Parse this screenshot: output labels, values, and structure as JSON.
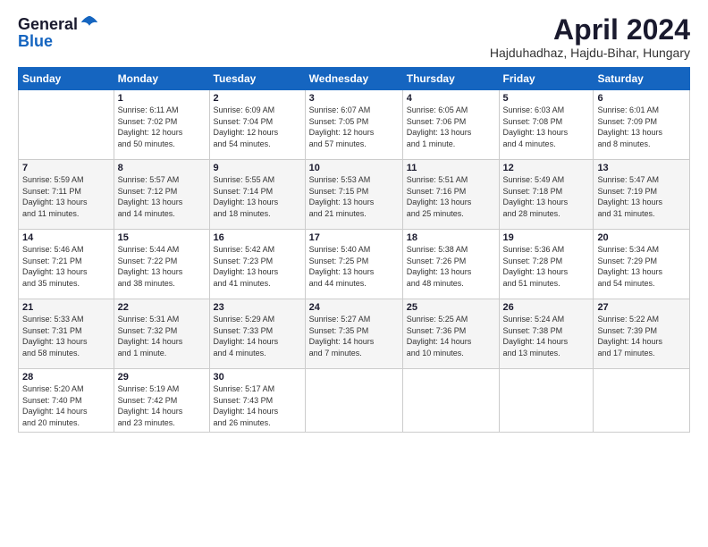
{
  "header": {
    "logo_line1": "General",
    "logo_line2": "Blue",
    "title": "April 2024",
    "subtitle": "Hajduhadhaz, Hajdu-Bihar, Hungary"
  },
  "weekdays": [
    "Sunday",
    "Monday",
    "Tuesday",
    "Wednesday",
    "Thursday",
    "Friday",
    "Saturday"
  ],
  "weeks": [
    [
      {
        "day": "",
        "info": ""
      },
      {
        "day": "1",
        "info": "Sunrise: 6:11 AM\nSunset: 7:02 PM\nDaylight: 12 hours\nand 50 minutes."
      },
      {
        "day": "2",
        "info": "Sunrise: 6:09 AM\nSunset: 7:04 PM\nDaylight: 12 hours\nand 54 minutes."
      },
      {
        "day": "3",
        "info": "Sunrise: 6:07 AM\nSunset: 7:05 PM\nDaylight: 12 hours\nand 57 minutes."
      },
      {
        "day": "4",
        "info": "Sunrise: 6:05 AM\nSunset: 7:06 PM\nDaylight: 13 hours\nand 1 minute."
      },
      {
        "day": "5",
        "info": "Sunrise: 6:03 AM\nSunset: 7:08 PM\nDaylight: 13 hours\nand 4 minutes."
      },
      {
        "day": "6",
        "info": "Sunrise: 6:01 AM\nSunset: 7:09 PM\nDaylight: 13 hours\nand 8 minutes."
      }
    ],
    [
      {
        "day": "7",
        "info": "Sunrise: 5:59 AM\nSunset: 7:11 PM\nDaylight: 13 hours\nand 11 minutes."
      },
      {
        "day": "8",
        "info": "Sunrise: 5:57 AM\nSunset: 7:12 PM\nDaylight: 13 hours\nand 14 minutes."
      },
      {
        "day": "9",
        "info": "Sunrise: 5:55 AM\nSunset: 7:14 PM\nDaylight: 13 hours\nand 18 minutes."
      },
      {
        "day": "10",
        "info": "Sunrise: 5:53 AM\nSunset: 7:15 PM\nDaylight: 13 hours\nand 21 minutes."
      },
      {
        "day": "11",
        "info": "Sunrise: 5:51 AM\nSunset: 7:16 PM\nDaylight: 13 hours\nand 25 minutes."
      },
      {
        "day": "12",
        "info": "Sunrise: 5:49 AM\nSunset: 7:18 PM\nDaylight: 13 hours\nand 28 minutes."
      },
      {
        "day": "13",
        "info": "Sunrise: 5:47 AM\nSunset: 7:19 PM\nDaylight: 13 hours\nand 31 minutes."
      }
    ],
    [
      {
        "day": "14",
        "info": "Sunrise: 5:46 AM\nSunset: 7:21 PM\nDaylight: 13 hours\nand 35 minutes."
      },
      {
        "day": "15",
        "info": "Sunrise: 5:44 AM\nSunset: 7:22 PM\nDaylight: 13 hours\nand 38 minutes."
      },
      {
        "day": "16",
        "info": "Sunrise: 5:42 AM\nSunset: 7:23 PM\nDaylight: 13 hours\nand 41 minutes."
      },
      {
        "day": "17",
        "info": "Sunrise: 5:40 AM\nSunset: 7:25 PM\nDaylight: 13 hours\nand 44 minutes."
      },
      {
        "day": "18",
        "info": "Sunrise: 5:38 AM\nSunset: 7:26 PM\nDaylight: 13 hours\nand 48 minutes."
      },
      {
        "day": "19",
        "info": "Sunrise: 5:36 AM\nSunset: 7:28 PM\nDaylight: 13 hours\nand 51 minutes."
      },
      {
        "day": "20",
        "info": "Sunrise: 5:34 AM\nSunset: 7:29 PM\nDaylight: 13 hours\nand 54 minutes."
      }
    ],
    [
      {
        "day": "21",
        "info": "Sunrise: 5:33 AM\nSunset: 7:31 PM\nDaylight: 13 hours\nand 58 minutes."
      },
      {
        "day": "22",
        "info": "Sunrise: 5:31 AM\nSunset: 7:32 PM\nDaylight: 14 hours\nand 1 minute."
      },
      {
        "day": "23",
        "info": "Sunrise: 5:29 AM\nSunset: 7:33 PM\nDaylight: 14 hours\nand 4 minutes."
      },
      {
        "day": "24",
        "info": "Sunrise: 5:27 AM\nSunset: 7:35 PM\nDaylight: 14 hours\nand 7 minutes."
      },
      {
        "day": "25",
        "info": "Sunrise: 5:25 AM\nSunset: 7:36 PM\nDaylight: 14 hours\nand 10 minutes."
      },
      {
        "day": "26",
        "info": "Sunrise: 5:24 AM\nSunset: 7:38 PM\nDaylight: 14 hours\nand 13 minutes."
      },
      {
        "day": "27",
        "info": "Sunrise: 5:22 AM\nSunset: 7:39 PM\nDaylight: 14 hours\nand 17 minutes."
      }
    ],
    [
      {
        "day": "28",
        "info": "Sunrise: 5:20 AM\nSunset: 7:40 PM\nDaylight: 14 hours\nand 20 minutes."
      },
      {
        "day": "29",
        "info": "Sunrise: 5:19 AM\nSunset: 7:42 PM\nDaylight: 14 hours\nand 23 minutes."
      },
      {
        "day": "30",
        "info": "Sunrise: 5:17 AM\nSunset: 7:43 PM\nDaylight: 14 hours\nand 26 minutes."
      },
      {
        "day": "",
        "info": ""
      },
      {
        "day": "",
        "info": ""
      },
      {
        "day": "",
        "info": ""
      },
      {
        "day": "",
        "info": ""
      }
    ]
  ]
}
